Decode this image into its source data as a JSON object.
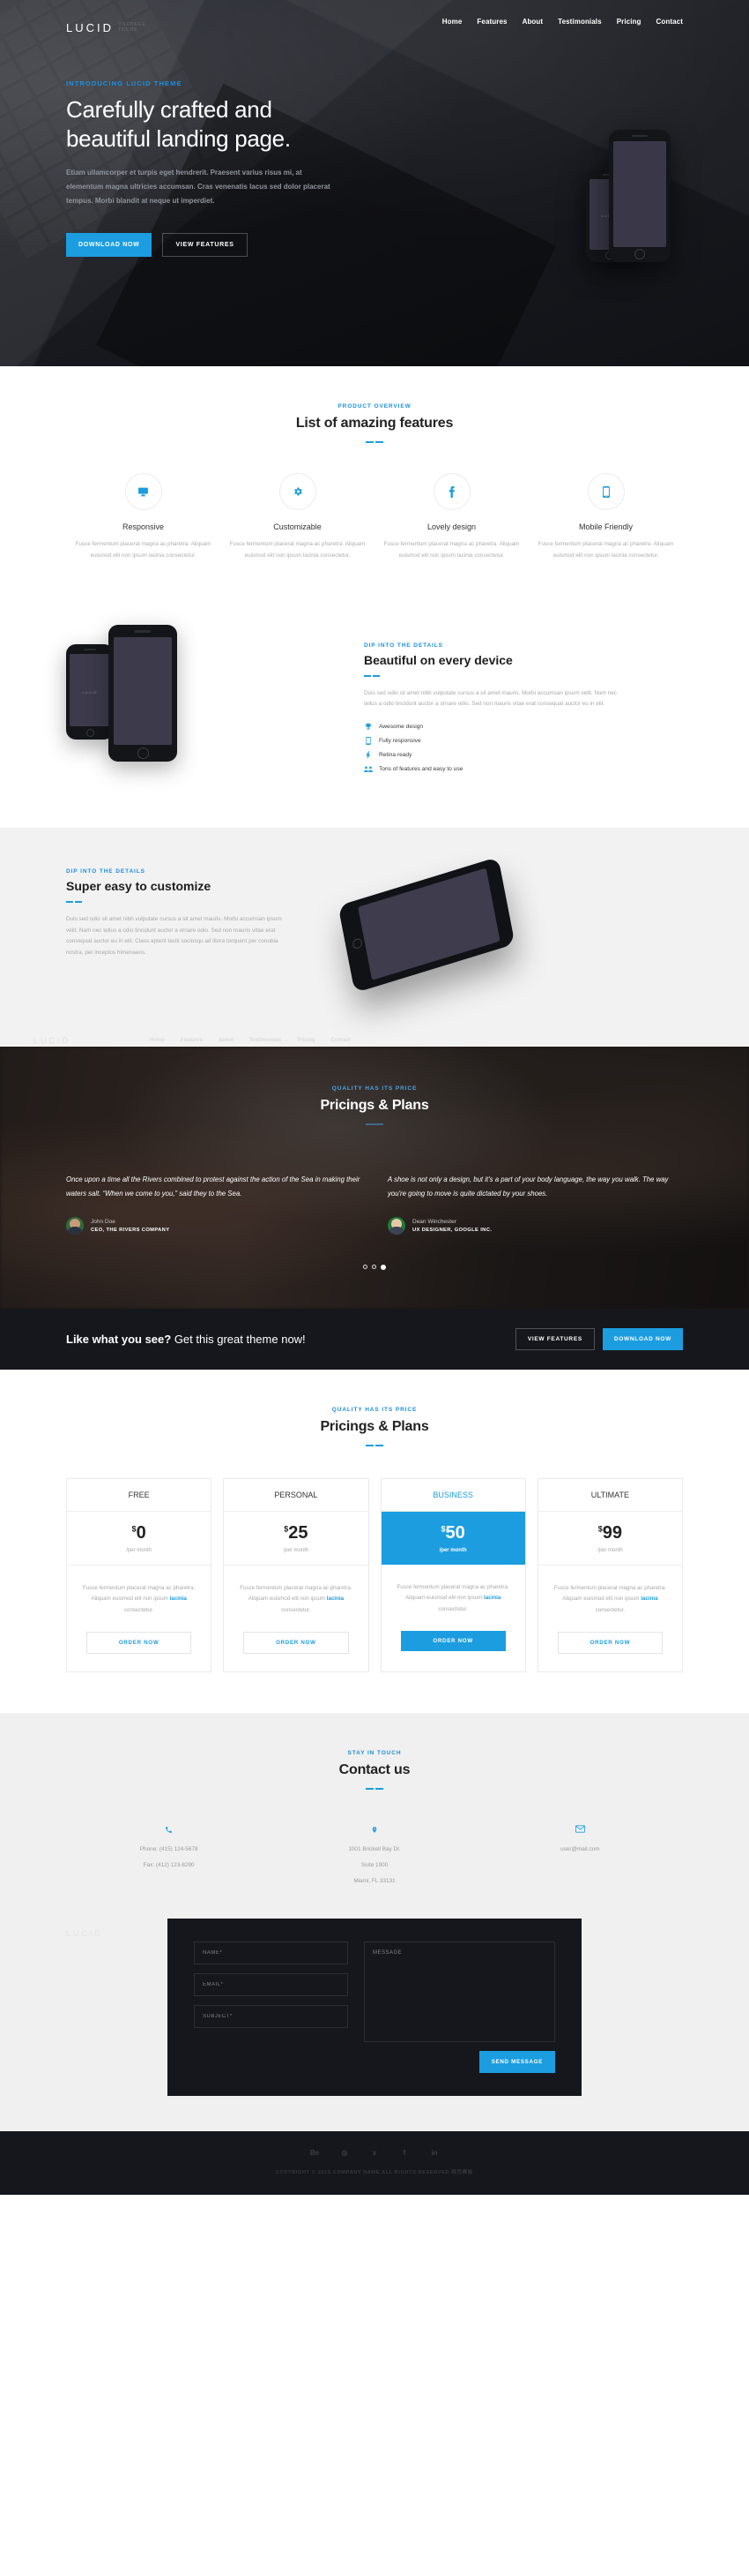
{
  "brand": {
    "name": "LUCID",
    "tagline_line1": "ONEPAGE",
    "tagline_line2": "THEME"
  },
  "nav": {
    "items": [
      {
        "label": "Home"
      },
      {
        "label": "Features"
      },
      {
        "label": "About"
      },
      {
        "label": "Testimonials"
      },
      {
        "label": "Pricing"
      },
      {
        "label": "Contact"
      }
    ]
  },
  "hero": {
    "eyebrow": "INTRODUCING LUCID THEME",
    "title": "Carefully crafted and beautiful landing page.",
    "paragraph": "Etiam ullamcorper et turpis eget hendrerit. Praesent varius risus mi, at elementum magna ultricies accumsan. Cras venenatis lacus sed dolor placerat tempus. Morbi blandit at neque ut imperdiet.",
    "primary_button": "DOWNLOAD NOW",
    "secondary_button": "VIEW FEATURES",
    "device_label": "LUCID"
  },
  "features": {
    "eyebrow": "PRODUCT OVERVIEW",
    "title": "List of amazing features",
    "items": [
      {
        "icon": "desktop-icon",
        "glyph": "⌸",
        "title": "Responsive",
        "text": "Fusce fermentum placerat magna ac pharetra. Aliquam euismod elit non ipsum lacinia consectetur."
      },
      {
        "icon": "gear-icon",
        "glyph": "⚙",
        "title": "Customizable",
        "text": "Fusce fermentum placerat magna ac pharetra. Aliquam euismod elit non ipsum lacinia consectetur."
      },
      {
        "icon": "facebook-icon",
        "glyph": "f",
        "title": "Lovely design",
        "text": "Fusce fermentum placerat magna ac pharetra. Aliquam euismod elit non ipsum lacinia consectetur."
      },
      {
        "icon": "mobile-icon",
        "glyph": "▯",
        "title": "Mobile Friendly",
        "text": "Fusce fermentum placerat magna ac pharetra. Aliquam euismod elit non ipsum lacinia consectetur."
      }
    ]
  },
  "device": {
    "eyebrow": "DIP INTO THE DETAILS",
    "title": "Beautiful on every device",
    "text": "Duis sed odio sit amet nibh vulputate cursus a sit amet mauris. Morbi accumsan ipsum velit. Nam nec tellus a odio tincidunt auctor a ornare odio. Sed non mauris vitae erat consequat auctor eu in elit.",
    "checks": [
      {
        "icon": "trophy-icon",
        "glyph": "♜",
        "label": "Awesome design"
      },
      {
        "icon": "mobile-icon",
        "glyph": "▯",
        "label": "Fully responsive"
      },
      {
        "icon": "bolt-icon",
        "glyph": "⚡",
        "label": "Retina ready"
      },
      {
        "icon": "users-icon",
        "glyph": "☸",
        "label": "Tons of features and easy to use"
      }
    ],
    "phone_label": "LUCID"
  },
  "customize": {
    "eyebrow": "DIP INTO THE DETAILS",
    "title": "Super easy to customize",
    "text": "Duis sed odio sit amet nibh vulputate cursus a sit amet mauris. Morbi accumsan ipsum velit. Nam nec tellus a odio tincidunt auctor a ornare odio. Sed non mauris vitae erat consequat auctor eu in elit. Class aptent taciti sociosqu ad litora torquent per conubia nostra, per inceptos himenaeos.",
    "ghost_logo": "LUCID",
    "ghost_nav": [
      "Home",
      "Features",
      "About",
      "Testimonials",
      "Pricing",
      "Contact"
    ]
  },
  "testimonials": {
    "eyebrow": "QUALITY HAS ITS PRICE",
    "title": "Pricings & Plans",
    "items": [
      {
        "quote": "Once upon a time all the Rivers combined to protest against the action of the Sea in making their waters salt. “When we come to you,” said they to the Sea.",
        "name": "John Doe",
        "role": "CEO, THE RIVERS COMPANY"
      },
      {
        "quote": "A shoe is not only a design, but it's a part of your body language, the way you walk. The way you're going to move is quite dictated by your shoes.",
        "name": "Dean Winchester",
        "role": "UX DESIGNER, GOOGLE INC."
      }
    ],
    "dots": [
      false,
      false,
      true
    ]
  },
  "cta": {
    "bold_text": "Like what you see?",
    "light_text": " Get this great theme now!",
    "secondary_button": "VIEW FEATURES",
    "primary_button": "DOWNLOAD NOW"
  },
  "pricing": {
    "eyebrow": "QUALITY HAS ITS PRICE",
    "title": "Pricings & Plans",
    "plans": [
      {
        "name": "FREE",
        "currency": "$",
        "amount": "0",
        "period": "/per month",
        "desc_before": "Fusce fermentum placerat magna ac pharetra. Aliquam euismod elit non ipsum ",
        "desc_link": "lacinia",
        "desc_after": " consectetur.",
        "button": "ORDER NOW",
        "featured": false
      },
      {
        "name": "PERSONAL",
        "currency": "$",
        "amount": "25",
        "period": "/per month",
        "desc_before": "Fusce fermentum placerat magna ac pharetra. Aliquam euismod elit non ipsum ",
        "desc_link": "lacinia",
        "desc_after": " consectetur.",
        "button": "ORDER NOW",
        "featured": false
      },
      {
        "name": "BUSINESS",
        "currency": "$",
        "amount": "50",
        "period": "/per month",
        "desc_before": "Fusce fermentum placerat magna ac pharetra. Aliquam euismod elit non ipsum ",
        "desc_link": "lacinia",
        "desc_after": " consectetur.",
        "button": "ORDER NOW",
        "featured": true
      },
      {
        "name": "ULTIMATE",
        "currency": "$",
        "amount": "99",
        "period": "/per month",
        "desc_before": "Fusce fermentum placerat magna ac pharetra. Aliquam euismod elit non ipsum ",
        "desc_link": "lacinia",
        "desc_after": " consectetur.",
        "button": "ORDER NOW",
        "featured": false
      }
    ]
  },
  "contact": {
    "eyebrow": "STAY IN TOUCH",
    "title": "Contact us",
    "ghost_logo": "LUCID",
    "blocks": [
      {
        "icon": "phone-icon",
        "glyph": "✆",
        "lines": [
          "Phone: (415) 124-5678",
          "Fax: (412) 123-8290"
        ]
      },
      {
        "icon": "map-pin-icon",
        "glyph": "⚉",
        "lines": [
          "1001 Brickell Bay Dr.",
          "Suite 1900",
          "Miami, FL 33131"
        ]
      },
      {
        "icon": "envelope-icon",
        "glyph": "✉",
        "lines": [
          "user@mail.com"
        ]
      }
    ],
    "form": {
      "name_placeholder": "NAME*",
      "email_placeholder": "EMAIL*",
      "subject_placeholder": "SUBJECT*",
      "message_placeholder": "MESSAGE",
      "submit_label": "SEND MESSAGE",
      "name_value": "",
      "email_value": "",
      "subject_value": "",
      "message_value": ""
    }
  },
  "footer": {
    "social": [
      {
        "name": "behance-icon",
        "glyph": "Be"
      },
      {
        "name": "dribbble-icon",
        "glyph": "◎"
      },
      {
        "name": "twitter-icon",
        "glyph": "ᴠ"
      },
      {
        "name": "facebook-icon",
        "glyph": "f"
      },
      {
        "name": "linkedin-icon",
        "glyph": "in"
      }
    ],
    "copyright": "COPYRIGHT © 2016.COMPANY NAME ALL RIGHTS RESERVED.网页模板"
  },
  "colors": {
    "accent": "#1b9de0",
    "dark": "#15171c",
    "muted": "#a9a9a9",
    "light_bg": "#f0f0f0"
  }
}
